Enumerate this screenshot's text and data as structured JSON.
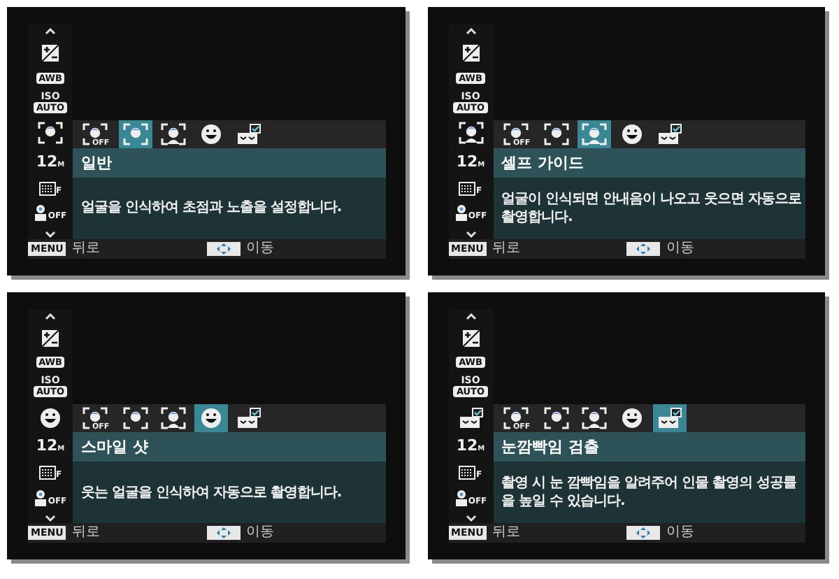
{
  "panels": [
    {
      "sidebar": [
        {
          "kind": "up"
        },
        {
          "kind": "ev"
        },
        {
          "kind": "label",
          "text": "AWB"
        },
        {
          "kind": "iso",
          "text": "ISO",
          "sub": "AUTO"
        },
        {
          "kind": "mode"
        },
        {
          "kind": "size",
          "text": "12",
          "unit": "M"
        },
        {
          "kind": "quality",
          "text": "F"
        },
        {
          "kind": "flash",
          "text": "OFF"
        },
        {
          "kind": "down"
        }
      ],
      "options": [
        {
          "kind": "face-off",
          "label": "OFF",
          "selected": false
        },
        {
          "kind": "face",
          "selected": true
        },
        {
          "kind": "self",
          "selected": false
        },
        {
          "kind": "smile",
          "selected": false
        },
        {
          "kind": "blink",
          "selected": false
        }
      ],
      "title": "일반",
      "description": "얼굴을 인식하여 초점과 노출을 설정합니다.",
      "footer": [
        {
          "kind": "menu",
          "key": "MENU",
          "label": "뒤로"
        },
        {
          "kind": "nav",
          "label": "이동"
        }
      ]
    },
    {
      "sidebar": [
        {
          "kind": "up"
        },
        {
          "kind": "ev"
        },
        {
          "kind": "label",
          "text": "AWB"
        },
        {
          "kind": "iso",
          "text": "ISO",
          "sub": "AUTO"
        },
        {
          "kind": "mode"
        },
        {
          "kind": "size",
          "text": "12",
          "unit": "M"
        },
        {
          "kind": "quality",
          "text": "F"
        },
        {
          "kind": "flash",
          "text": "OFF"
        },
        {
          "kind": "down"
        }
      ],
      "options": [
        {
          "kind": "face-off",
          "label": "OFF",
          "selected": false
        },
        {
          "kind": "face",
          "selected": false
        },
        {
          "kind": "self",
          "selected": true
        },
        {
          "kind": "smile",
          "selected": false
        },
        {
          "kind": "blink",
          "selected": false
        }
      ],
      "title": "셀프 가이드",
      "description": "얼굴이 인식되면 안내음이 나오고 웃으면 자동으로 촬영합니다.",
      "footer": [
        {
          "kind": "menu",
          "key": "MENU",
          "label": "뒤로"
        },
        {
          "kind": "nav",
          "label": "이동"
        }
      ]
    },
    {
      "sidebar": [
        {
          "kind": "up"
        },
        {
          "kind": "ev"
        },
        {
          "kind": "label",
          "text": "AWB"
        },
        {
          "kind": "iso",
          "text": "ISO",
          "sub": "AUTO"
        },
        {
          "kind": "mode"
        },
        {
          "kind": "size",
          "text": "12",
          "unit": "M"
        },
        {
          "kind": "quality",
          "text": "F"
        },
        {
          "kind": "flash",
          "text": "OFF"
        },
        {
          "kind": "down"
        }
      ],
      "options": [
        {
          "kind": "face-off",
          "label": "OFF",
          "selected": false
        },
        {
          "kind": "face",
          "selected": false
        },
        {
          "kind": "self",
          "selected": false
        },
        {
          "kind": "smile",
          "selected": true
        },
        {
          "kind": "blink",
          "selected": false
        }
      ],
      "title": "스마일 샷",
      "description": "웃는 얼굴을 인식하여 자동으로 촬영합니다.",
      "footer": [
        {
          "kind": "menu",
          "key": "MENU",
          "label": "뒤로"
        },
        {
          "kind": "nav",
          "label": "이동"
        }
      ]
    },
    {
      "sidebar": [
        {
          "kind": "up"
        },
        {
          "kind": "ev"
        },
        {
          "kind": "label",
          "text": "AWB"
        },
        {
          "kind": "iso",
          "text": "ISO",
          "sub": "AUTO"
        },
        {
          "kind": "mode"
        },
        {
          "kind": "size",
          "text": "12",
          "unit": "M"
        },
        {
          "kind": "quality",
          "text": "F"
        },
        {
          "kind": "flash",
          "text": "OFF"
        },
        {
          "kind": "down"
        }
      ],
      "options": [
        {
          "kind": "face-off",
          "label": "OFF",
          "selected": false
        },
        {
          "kind": "face",
          "selected": false
        },
        {
          "kind": "self",
          "selected": false
        },
        {
          "kind": "smile",
          "selected": false
        },
        {
          "kind": "blink",
          "selected": true
        }
      ],
      "title": "눈깜빡임 검출",
      "description": "촬영 시 눈 깜빡임을 알려주어 인물 촬영의 성공률을 높일 수 있습니다.",
      "footer": [
        {
          "kind": "menu",
          "key": "MENU",
          "label": "뒤로"
        },
        {
          "kind": "nav",
          "label": "이동"
        }
      ]
    }
  ]
}
